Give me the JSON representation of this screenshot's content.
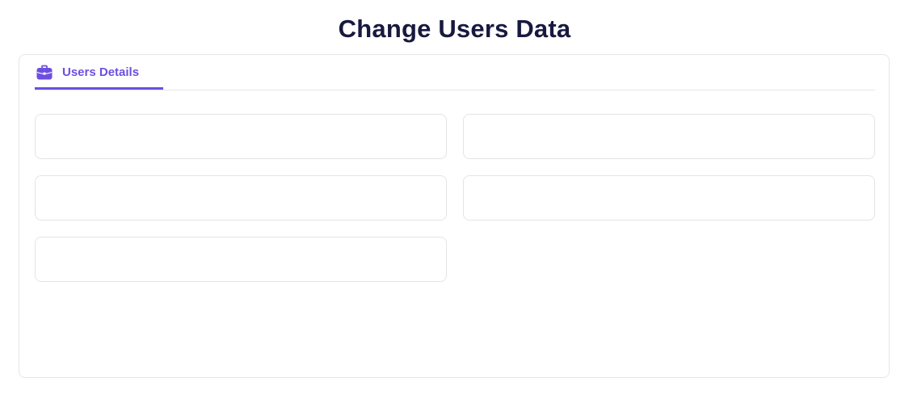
{
  "page": {
    "title": "Change Users Data"
  },
  "tabs": [
    {
      "label": "Users Details",
      "icon": "briefcase-icon",
      "active": true
    }
  ],
  "form": {
    "fields": [
      {
        "value": "",
        "placeholder": ""
      },
      {
        "value": "",
        "placeholder": ""
      },
      {
        "value": "",
        "placeholder": ""
      },
      {
        "value": "",
        "placeholder": ""
      },
      {
        "value": "",
        "placeholder": ""
      }
    ]
  },
  "colors": {
    "accent": "#6d4fe0",
    "title": "#17193f",
    "border": "#e6e6ea"
  }
}
